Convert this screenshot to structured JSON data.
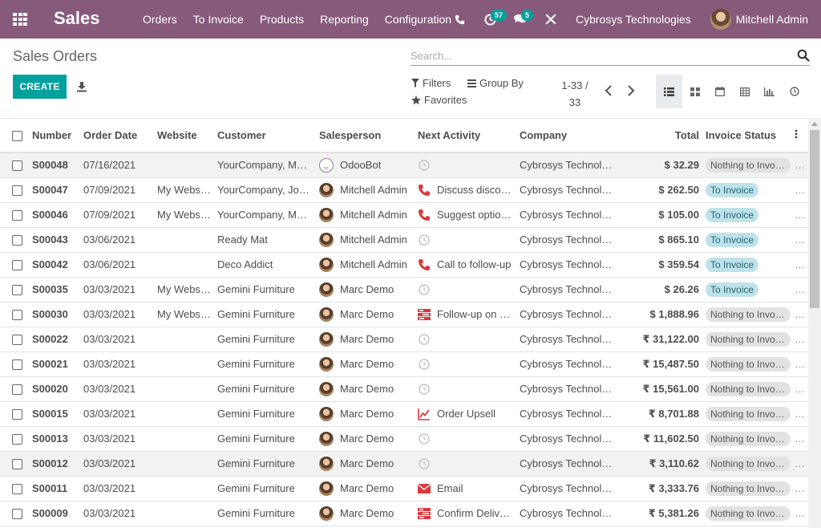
{
  "navbar": {
    "app_name": "Sales",
    "menu": [
      "Orders",
      "To Invoice",
      "Products",
      "Reporting",
      "Configuration"
    ],
    "activity_count": "57",
    "message_count": "5",
    "company": "Cybrosys Technologies",
    "user": "Mitchell Admin"
  },
  "control_panel": {
    "title": "Sales Orders",
    "search_placeholder": "Search...",
    "create_label": "CREATE",
    "filters_label": "Filters",
    "groupby_label": "Group By",
    "favorites_label": "Favorites",
    "pager": "1-33 / 33",
    "active_view": "list"
  },
  "table": {
    "columns": [
      "Number",
      "Order Date",
      "Website",
      "Customer",
      "Salesperson",
      "Next Activity",
      "Company",
      "Total",
      "Invoice Status"
    ],
    "rows": [
      {
        "number": "S00048",
        "date": "07/16/2021",
        "website": "",
        "customer": "YourCompany, Marc Demo",
        "salesperson": "OdooBot",
        "sp_avatar": "bot",
        "activity": "",
        "activity_icon": "clock",
        "company": "Cybrosys Technologies",
        "total": "$ 32.29",
        "status": "Nothing to Invoice",
        "status_type": "nothing"
      },
      {
        "number": "S00047",
        "date": "07/09/2021",
        "website": "My Website",
        "customer": "YourCompany, Joel Willis",
        "salesperson": "Mitchell Admin",
        "sp_avatar": "person",
        "activity": "Discuss discount",
        "activity_icon": "phone",
        "company": "Cybrosys Technologies",
        "total": "$ 262.50",
        "status": "To Invoice",
        "status_type": "invoice"
      },
      {
        "number": "S00046",
        "date": "07/09/2021",
        "website": "My Website",
        "customer": "YourCompany, Marc Demo",
        "salesperson": "Mitchell Admin",
        "sp_avatar": "person",
        "activity": "Suggest optional products",
        "activity_icon": "phone",
        "company": "Cybrosys Technologies",
        "total": "$ 105.00",
        "status": "To Invoice",
        "status_type": "invoice"
      },
      {
        "number": "S00043",
        "date": "03/06/2021",
        "website": "",
        "customer": "Ready Mat",
        "salesperson": "Mitchell Admin",
        "sp_avatar": "person",
        "activity": "",
        "activity_icon": "clock",
        "company": "Cybrosys Technologies",
        "total": "$ 865.10",
        "status": "To Invoice",
        "status_type": "invoice"
      },
      {
        "number": "S00042",
        "date": "03/06/2021",
        "website": "",
        "customer": "Deco Addict",
        "salesperson": "Mitchell Admin",
        "sp_avatar": "person",
        "activity": "Call to follow-up",
        "activity_icon": "phone",
        "company": "Cybrosys Technologies",
        "total": "$ 359.54",
        "status": "To Invoice",
        "status_type": "invoice"
      },
      {
        "number": "S00035",
        "date": "03/03/2021",
        "website": "My Website",
        "customer": "Gemini Furniture",
        "salesperson": "Marc Demo",
        "sp_avatar": "person",
        "activity": "",
        "activity_icon": "clock",
        "company": "Cybrosys Technologies",
        "total": "$ 26.26",
        "status": "To Invoice",
        "status_type": "invoice"
      },
      {
        "number": "S00030",
        "date": "03/03/2021",
        "website": "My Website",
        "customer": "Gemini Furniture",
        "salesperson": "Marc Demo",
        "sp_avatar": "person",
        "activity": "Follow-up on satisfaction",
        "activity_icon": "tasks",
        "company": "Cybrosys Technologies",
        "total": "$ 1,888.96",
        "status": "Nothing to Invoice",
        "status_type": "nothing"
      },
      {
        "number": "S00022",
        "date": "03/03/2021",
        "website": "",
        "customer": "Gemini Furniture",
        "salesperson": "Marc Demo",
        "sp_avatar": "person",
        "activity": "",
        "activity_icon": "clock",
        "company": "Cybrosys Technologies",
        "total": "₹ 31,122.00",
        "status": "Nothing to Invoice",
        "status_type": "nothing"
      },
      {
        "number": "S00021",
        "date": "03/03/2021",
        "website": "",
        "customer": "Gemini Furniture",
        "salesperson": "Marc Demo",
        "sp_avatar": "person",
        "activity": "",
        "activity_icon": "clock",
        "company": "Cybrosys Technologies",
        "total": "₹ 15,487.50",
        "status": "Nothing to Invoice",
        "status_type": "nothing"
      },
      {
        "number": "S00020",
        "date": "03/03/2021",
        "website": "",
        "customer": "Gemini Furniture",
        "salesperson": "Marc Demo",
        "sp_avatar": "person",
        "activity": "",
        "activity_icon": "clock",
        "company": "Cybrosys Technologies",
        "total": "₹ 15,561.00",
        "status": "Nothing to Invoice",
        "status_type": "nothing"
      },
      {
        "number": "S00015",
        "date": "03/03/2021",
        "website": "",
        "customer": "Gemini Furniture",
        "salesperson": "Marc Demo",
        "sp_avatar": "person",
        "activity": "Order Upsell",
        "activity_icon": "chart",
        "company": "Cybrosys Technologies",
        "total": "₹ 8,701.88",
        "status": "Nothing to Invoice",
        "status_type": "nothing"
      },
      {
        "number": "S00013",
        "date": "03/03/2021",
        "website": "",
        "customer": "Gemini Furniture",
        "salesperson": "Marc Demo",
        "sp_avatar": "person",
        "activity": "",
        "activity_icon": "clock",
        "company": "Cybrosys Technologies",
        "total": "₹ 11,602.50",
        "status": "Nothing to Invoice",
        "status_type": "nothing"
      },
      {
        "number": "S00012",
        "date": "03/03/2021",
        "website": "",
        "customer": "Gemini Furniture",
        "salesperson": "Marc Demo",
        "sp_avatar": "person",
        "activity": "",
        "activity_icon": "clock",
        "company": "Cybrosys Technologies",
        "total": "₹ 3,110.62",
        "status": "Nothing to Invoice",
        "status_type": "nothing"
      },
      {
        "number": "S00011",
        "date": "03/03/2021",
        "website": "",
        "customer": "Gemini Furniture",
        "salesperson": "Marc Demo",
        "sp_avatar": "person",
        "activity": "Email",
        "activity_icon": "email",
        "company": "Cybrosys Technologies",
        "total": "₹ 3,333.76",
        "status": "Nothing to Invoice",
        "status_type": "nothing"
      },
      {
        "number": "S00009",
        "date": "03/03/2021",
        "website": "",
        "customer": "Gemini Furniture",
        "salesperson": "Marc Demo",
        "sp_avatar": "person",
        "activity": "Confirm Delivery",
        "activity_icon": "tasks",
        "company": "Cybrosys Technologies",
        "total": "₹ 5,381.26",
        "status": "Nothing to Invoice",
        "status_type": "nothing"
      }
    ]
  }
}
